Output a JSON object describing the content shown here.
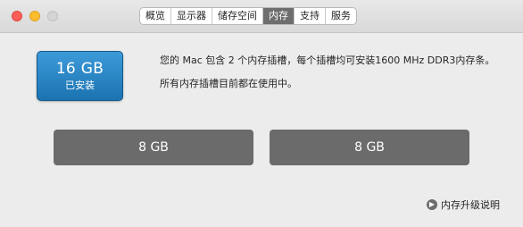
{
  "tabs": [
    {
      "label": "概览",
      "active": false
    },
    {
      "label": "显示器",
      "active": false
    },
    {
      "label": "储存空间",
      "active": false
    },
    {
      "label": "内存",
      "active": true
    },
    {
      "label": "支持",
      "active": false
    },
    {
      "label": "服务",
      "active": false
    }
  ],
  "memory": {
    "total": "16 GB",
    "status": "已安装",
    "description": "您的 Mac 包含 2 个内存插槽，每个插槽均可安装1600 MHz DDR3内存条。",
    "slot_status": "所有内存插槽目前都在使用中。",
    "slots": [
      "8 GB",
      "8 GB"
    ]
  },
  "upgrade_link": "内存升级说明",
  "colors": {
    "badge": "#2a86c6",
    "active_tab": "#6e6e6e",
    "slot": "#6b6b6b"
  }
}
